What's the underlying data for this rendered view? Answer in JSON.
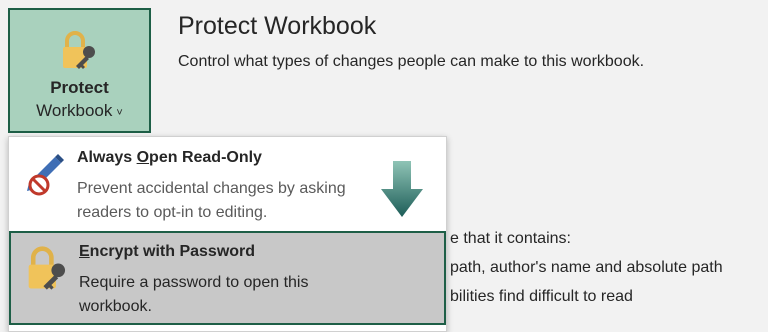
{
  "protect": {
    "label_line1": "Protect",
    "label_line2": "Workbook",
    "chevron": "˅",
    "icon": "lock-key-icon"
  },
  "header": {
    "title": "Protect Workbook",
    "description": "Control what types of changes people can make to this workbook."
  },
  "background_lines": [
    "e that it contains:",
    "path, author's name and absolute path",
    "bilities find difficult to read"
  ],
  "menu": {
    "items": [
      {
        "title_pre": "Always ",
        "title_accel": "O",
        "title_post": "pen Read-Only",
        "description": "Prevent accidental changes by asking readers to opt-in to editing.",
        "icon": "pencil-prohibited-icon"
      },
      {
        "title_pre": "",
        "title_accel": "E",
        "title_post": "ncrypt with Password",
        "description": "Require a password to open this workbook.",
        "icon": "lock-key-icon"
      }
    ]
  },
  "colors": {
    "accent": "#1e5f47",
    "button_bg": "#a9d1bd",
    "selected_item_bg": "#c8c8c8"
  }
}
